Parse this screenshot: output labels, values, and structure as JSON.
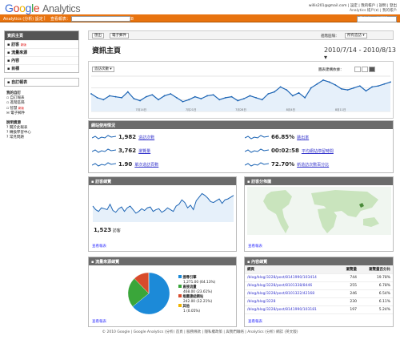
{
  "app": {
    "logo_parts": [
      "G",
      "o",
      "o",
      "g",
      "l",
      "e"
    ],
    "product": "Analytics"
  },
  "account": {
    "email": "willis201@gmail.com",
    "links": "| 設定 | 我的帳戶 | 說明 | 登出",
    "sub": "Analytics 帳戶(▾) | 我的帳戶"
  },
  "topbar": {
    "left": "Analytics (分析) 設定",
    "sep": "|",
    "reports": "查看報表：",
    "site": "blog.ilc.edu.tw/blog/blog/3228",
    "acct": "我的使用者帳號"
  },
  "sidebar": {
    "nav_header": "資訊主頁",
    "items": [
      {
        "label": "訪客"
      },
      {
        "label": "流量來源"
      },
      {
        "label": "內容"
      },
      {
        "label": "目標"
      }
    ],
    "new_label": "新版",
    "custom": "自訂報表",
    "my_custom": {
      "title": "我的自訂",
      "items": [
        "自訂報表",
        "進階區隔",
        "智慧",
        "電子郵件"
      ]
    },
    "help": {
      "title": "說明資源",
      "items": [
        "關於此報表",
        "轉換學習中心",
        "常見問題"
      ]
    }
  },
  "toolbar": {
    "export": "匯出",
    "email": "電子郵件",
    "segment_label": "進階區隔：",
    "segment_value": "所有造訪 ▾"
  },
  "header": {
    "title": "資訊主頁",
    "date": "2010/7/14 - 2010/8/13",
    "graph_label": "圖表建構依據：",
    "dropdown": "造訪次數 ▾"
  },
  "chart_data": {
    "type": "line",
    "title": "",
    "xlabel": "",
    "ylabel": "",
    "x_ticks": [
      "7月14日",
      "7月21日",
      "7月28日",
      "8月4日",
      "8月11日"
    ],
    "values": [
      18,
      14,
      12,
      16,
      15,
      14,
      20,
      13,
      11,
      15,
      17,
      12,
      16,
      18,
      14,
      10,
      12,
      15,
      13,
      16,
      17,
      12,
      14,
      15,
      11,
      13,
      16,
      14,
      12,
      18,
      20,
      25,
      22,
      16,
      19,
      14,
      24,
      28,
      32,
      30,
      27,
      23,
      22,
      24,
      26,
      21,
      25,
      26,
      28,
      30
    ]
  },
  "usage": {
    "title": "網站使用情況",
    "metrics": [
      {
        "value": "1,982",
        "label": "造訪次數"
      },
      {
        "value": "3,762",
        "label": "瀏覽量"
      },
      {
        "value": "1.90",
        "label": "單次造訪頁數"
      },
      {
        "value": "66.85%",
        "label": "跳出率"
      },
      {
        "value": "00:02:58",
        "label": "平均網站停留時間"
      },
      {
        "value": "72.70%",
        "label": "新造訪次數百分比"
      }
    ]
  },
  "visitors": {
    "title": "訪客總覽",
    "count": "1,523",
    "count_label": "訪客",
    "view": "查看報表"
  },
  "map": {
    "title": "訪客分佈圖",
    "view": "查看報表"
  },
  "traffic": {
    "title": "流量來源總覽",
    "view": "查看報表",
    "legend": [
      {
        "label": "搜尋引擎",
        "value": "1,271.00 (64.13%)",
        "color": "#1c8ad8"
      },
      {
        "label": "直接流量",
        "value": "468.00 (23.61%)",
        "color": "#3aa63a"
      },
      {
        "label": "推薦連結網站",
        "value": "242.00 (12.21%)",
        "color": "#d84b2b"
      },
      {
        "label": "其他",
        "value": "1 (0.05%)",
        "color": "#f0b400"
      }
    ],
    "slices": [
      64.13,
      23.61,
      12.21,
      0.05
    ]
  },
  "content": {
    "title": "內容總覽",
    "view": "查看報表",
    "cols": [
      "網頁",
      "瀏覽量",
      "瀏覽量百分比"
    ],
    "rows": [
      [
        "/blog/blog/3228/post/8141990/103414",
        "744",
        "19.78%"
      ],
      [
        "/blog/blog/3228/post/8101338/8446",
        "255",
        "6.78%"
      ],
      [
        "/blog/blog/3228/post/8101322/42168",
        "246",
        "6.54%"
      ],
      [
        "/blog/blog/3228",
        "230",
        "6.11%"
      ],
      [
        "/blog/blog/3228/post/8141990/103181",
        "197",
        "5.24%"
      ]
    ]
  },
  "footer": "© 2010 Google | Google Analytics (分析) 首頁 | 服務條款 | 隱私權政策 | 與我們聯絡 | Analytics (分析) 網誌 (英文版)"
}
